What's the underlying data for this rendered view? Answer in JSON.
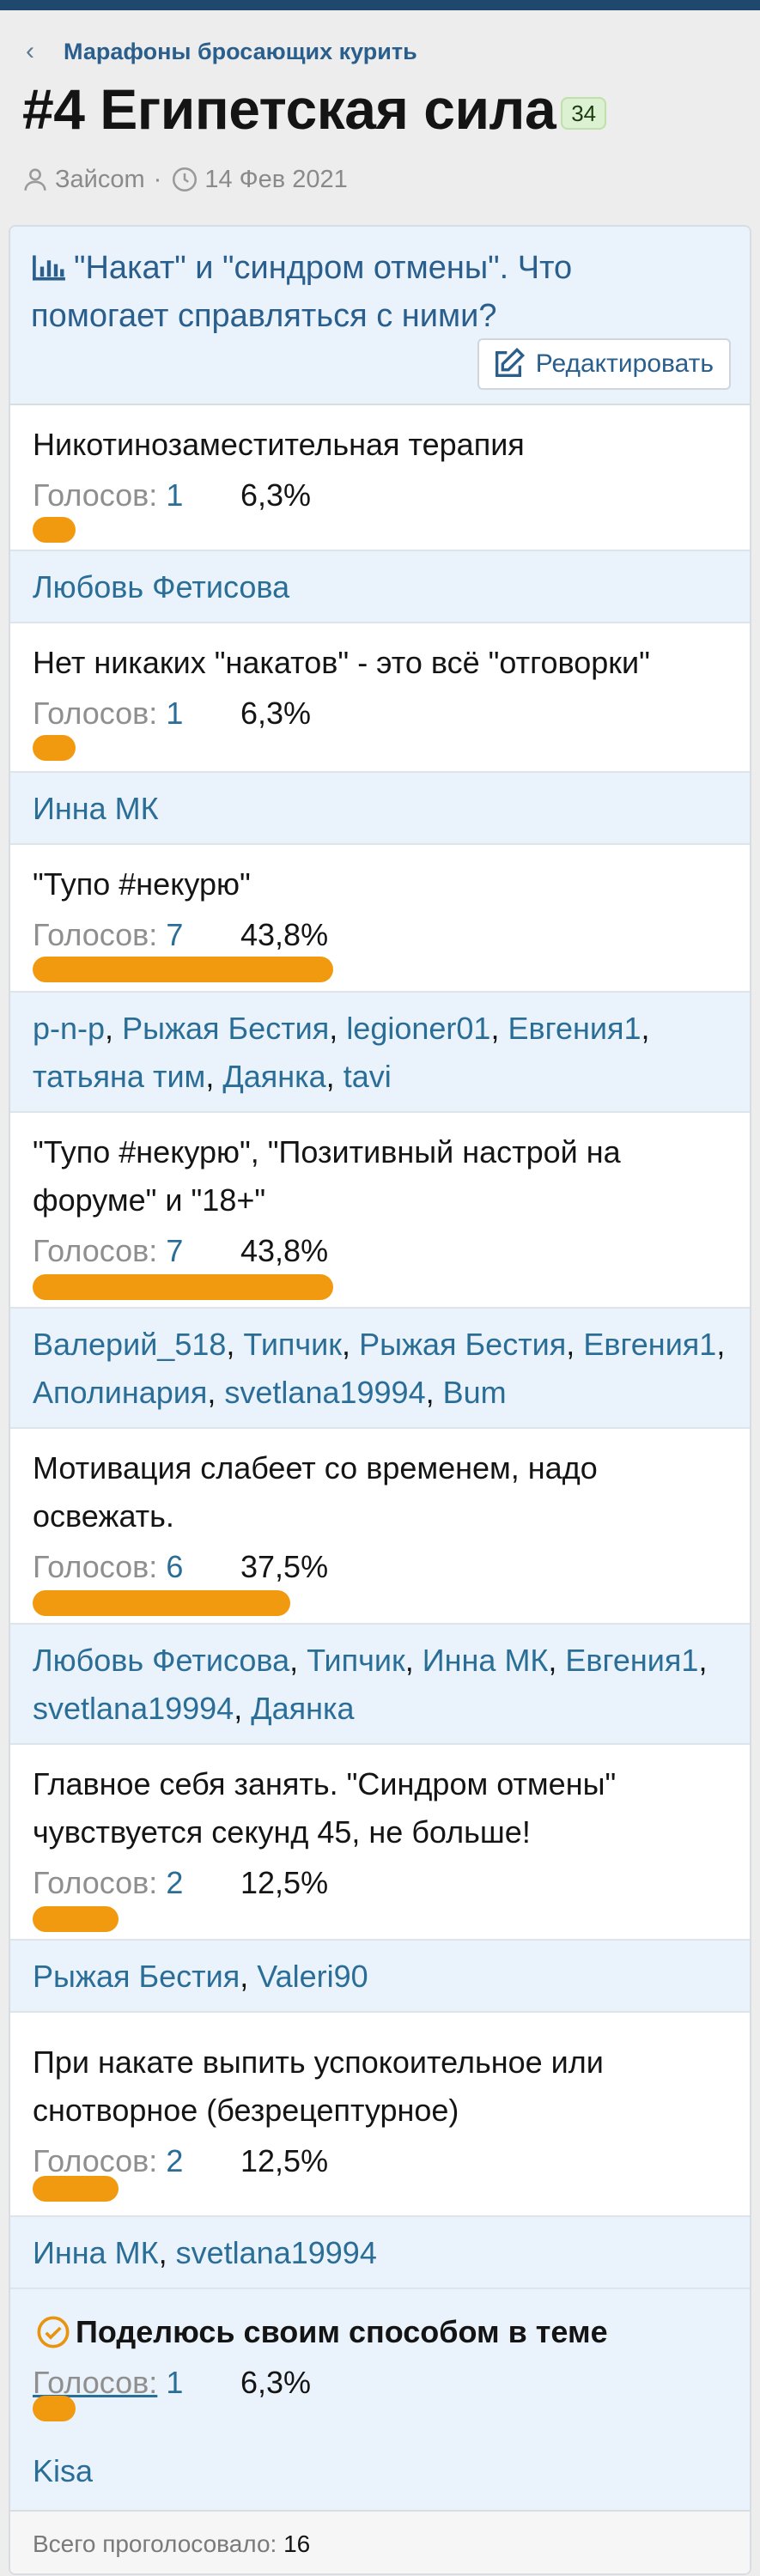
{
  "breadcrumb": {
    "label": "Марафоны бросающих курить"
  },
  "thread": {
    "title": "#4 Египетская сила",
    "badge": "34",
    "author": "Зайсom",
    "date": "14 Фев 2021"
  },
  "poll": {
    "question": "\"Накат\" и \"синдром отмены\". Что помогает справляться с ними?",
    "edit_label": "Редактировать",
    "votes_label": "Голосов:",
    "options": [
      {
        "text": "Никотинозаместительная терапия",
        "votes": "1",
        "percent": "6,3%",
        "fraction": 0.063,
        "voters": [
          "Любовь Фетисова"
        ]
      },
      {
        "text": "Нет никаких \"накатов\" - это всё \"отговорки\"",
        "votes": "1",
        "percent": "6,3%",
        "fraction": 0.063,
        "voters": [
          "Инна МК"
        ]
      },
      {
        "text": "\"Тупо #некурю\"",
        "votes": "7",
        "percent": "43,8%",
        "fraction": 0.438,
        "voters": [
          "p-n-p",
          "Рыжая Бестия",
          "legioner01",
          "Евгения1",
          "татьяна тим",
          "Даянка",
          "tavi"
        ]
      },
      {
        "text": "\"Тупо #некурю\", \"Позитивный настрой на форуме\" и \"18+\"",
        "votes": "7",
        "percent": "43,8%",
        "fraction": 0.438,
        "voters": [
          "Валерий_518",
          "Типчик",
          "Рыжая Бестия",
          "Евгения1",
          "Аполинария",
          "svetlana19994",
          "Bum"
        ]
      },
      {
        "text": "Мотивация слабеет со временем, надо освежать.",
        "votes": "6",
        "percent": "37,5%",
        "fraction": 0.375,
        "voters": [
          "Любовь Фетисова",
          "Типчик",
          "Инна МК",
          "Евгения1",
          "svetlana19994",
          "Даянка"
        ]
      },
      {
        "text": "Главное себя занять. \"Синдром отмены\" чувствуется секунд 45, не больше!",
        "votes": "2",
        "percent": "12,5%",
        "fraction": 0.125,
        "voters": [
          "Рыжая Бестия",
          "Valeri90"
        ]
      },
      {
        "text": "При накате выпить успокоительное или снотворное (безрецептурное)",
        "votes": "2",
        "percent": "12,5%",
        "fraction": 0.125,
        "voters": [
          "Инна МК",
          "svetlana19994"
        ]
      },
      {
        "text": "Поделюсь своим способом в теме",
        "votes": "1",
        "percent": "6,3%",
        "fraction": 0.063,
        "voters": [
          "Kisa"
        ],
        "selected": true
      }
    ],
    "total_label": "Всего проголосовало:",
    "total": "16"
  },
  "colors": {
    "accent": "#2a6e98",
    "bar": "#f29a0f",
    "voters_bg": "#eaf3fb",
    "header": "#20486e"
  },
  "icons": {
    "back": "chevron-left-icon",
    "author": "user-icon",
    "date": "clock-icon",
    "poll": "bar-chart-icon",
    "edit": "edit-icon",
    "selected": "check-circle-icon"
  }
}
